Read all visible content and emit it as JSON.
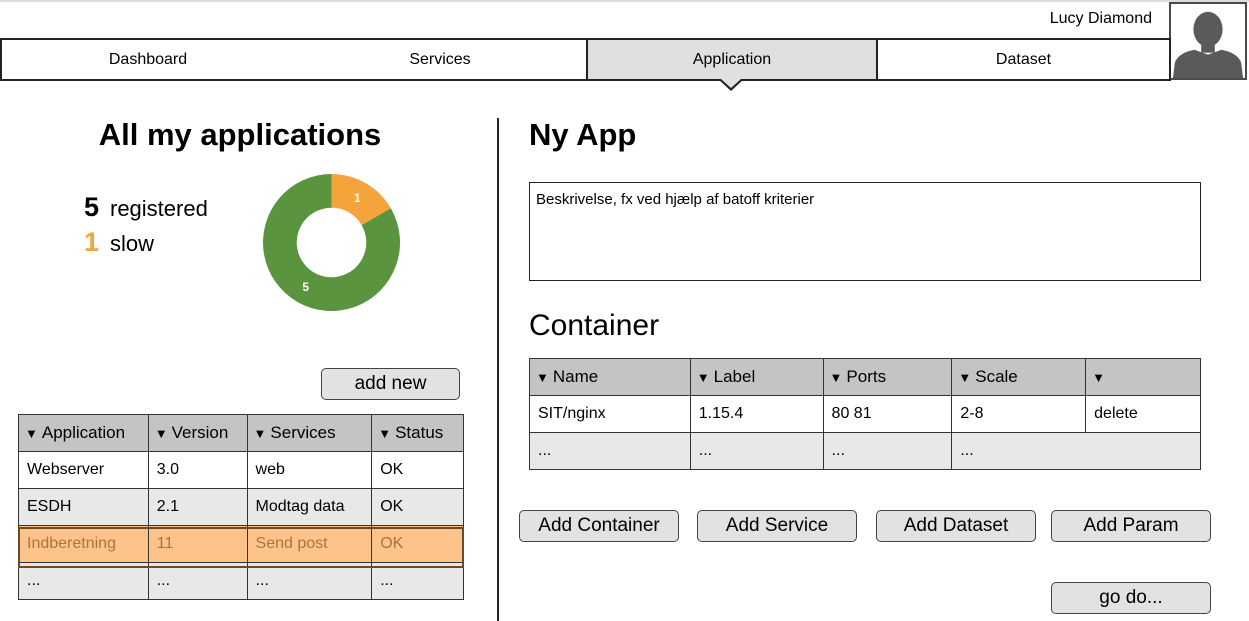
{
  "header": {
    "username": "Lucy Diamond",
    "avatar_icon": "user-silhouette-icon"
  },
  "nav": {
    "tabs": [
      "Dashboard",
      "Services",
      "Application",
      "Dataset"
    ],
    "active_tab": "Application"
  },
  "left": {
    "title": "All my applications",
    "stats": {
      "registered_count": "5",
      "registered_label": "registered",
      "slow_count": "1",
      "slow_label": "slow"
    },
    "donut": {
      "segments": [
        {
          "label": "1",
          "value": 1,
          "color": "#f4a43a"
        },
        {
          "label": "5",
          "value": 5,
          "color": "#5a943e"
        }
      ]
    },
    "add_new_label": "add new",
    "table": {
      "headers": [
        "Application",
        "Version",
        "Services",
        "Status"
      ],
      "rows": [
        [
          "Webserver",
          "3.0",
          "web",
          "OK"
        ],
        [
          "ESDH",
          "2.1",
          "Modtag data",
          "OK"
        ],
        [
          "Indberetning",
          "11",
          "Send post",
          "OK"
        ],
        [
          "...",
          "...",
          "...",
          "..."
        ]
      ],
      "highlight_color": "#fcc48a"
    }
  },
  "right": {
    "title": "Ny App",
    "description": "Beskrivelse, fx ved hjælp af batoff kriterier",
    "container_title": "Container",
    "container_table": {
      "headers": [
        "Name",
        "Label",
        "Ports",
        "Scale",
        ""
      ],
      "rows": [
        [
          "SIT/nginx",
          "1.15.4",
          "80 81",
          "2-8",
          "delete"
        ],
        [
          "...",
          "...",
          "...",
          "..."
        ]
      ]
    },
    "buttons": {
      "add_container": "Add Container",
      "add_service": "Add Service",
      "add_dataset": "Add Dataset",
      "add_param": "Add Param",
      "go_do": "go do..."
    }
  }
}
